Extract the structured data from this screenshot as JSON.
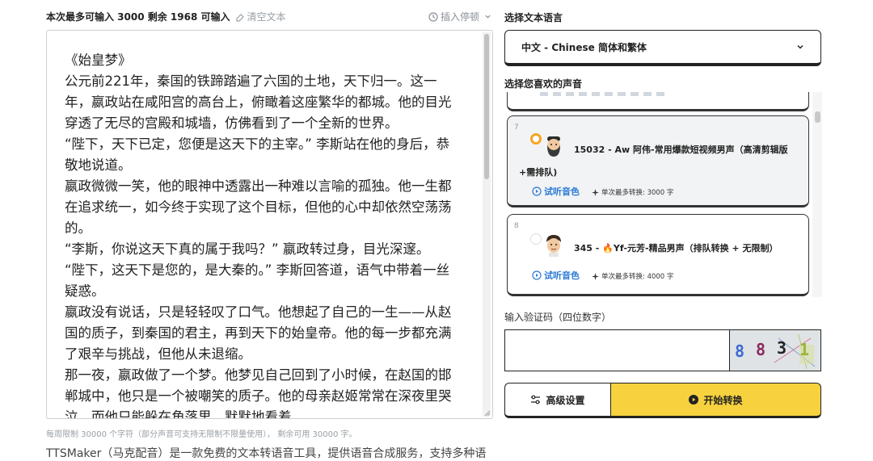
{
  "header": {
    "char_limit_text": "本次最多可输入 3000 剩余 1968 可输入",
    "clear_label": "清空文本",
    "insert_pause_label": "插入停顿"
  },
  "editor": {
    "paragraphs": [
      "《始皇梦》",
      "公元前221年，秦国的铁蹄踏遍了六国的土地，天下归一。这一年，嬴政站在咸阳宫的高台上，俯瞰着这座繁华的都城。他的目光穿透了无尽的宫殿和城墙，仿佛看到了一个全新的世界。",
      "“陛下，天下已定，您便是这天下的主宰。” 李斯站在他的身后，恭敬地说道。",
      "嬴政微微一笑，他的眼神中透露出一种难以言喻的孤独。他一生都在追求统一，如今终于实现了这个目标，但他的心中却依然空荡荡的。",
      "“李斯，你说这天下真的属于我吗？” 嬴政转过身，目光深邃。",
      "“陛下，这天下是您的，是大秦的。” 李斯回答道，语气中带着一丝疑惑。",
      "嬴政没有说话，只是轻轻叹了口气。他想起了自己的一生——从赵国的质子，到秦国的君主，再到天下的始皇帝。他的每一步都充满了艰辛与挑战，但他从未退缩。",
      "那一夜，嬴政做了一个梦。他梦见自己回到了小时候，在赵国的邯郸城中，他只是一个被嘲笑的质子。他的母亲赵姬常常在深夜里哭泣，而他只能躲在角落里，默默地看着。"
    ],
    "limit_note": "每周限制 30000 个字符（部分声音可支持无限制不限量使用）， 剩余可用 30000 字。",
    "about_text": "TTSMaker（马克配音）是一款免费的文本转语音工具，提供语音合成服务，支持多种语"
  },
  "language": {
    "label": "选择文本语言",
    "selected": "中文 - Chinese 简体和繁体"
  },
  "voices": {
    "label": "选择您喜欢的声音",
    "items": [
      {
        "index": "7",
        "name_line1": "15032 - Aw 阿伟-常用爆款短视频男声（高清剪辑版",
        "name_line2": "+需排队)",
        "listen_label": "试听音色",
        "max_label": "单次最多转换: 3000 字",
        "selected": true
      },
      {
        "index": "8",
        "name_line1": "345 - 🔥Yf-元芳-精品男声（排队转换 + 无限制）",
        "listen_label": "试听音色",
        "max_label": "单次最多转换: 4000 字",
        "selected": false
      }
    ]
  },
  "captcha": {
    "label": "输入验证码（四位数字）",
    "value": "",
    "image_digits": [
      "8",
      "8",
      "3",
      "1"
    ]
  },
  "actions": {
    "advanced_label": "高级设置",
    "start_label": "开始转换"
  },
  "colors": {
    "accent_yellow": "#f7d23e",
    "link_blue": "#2a7ad5",
    "radio_orange": "#f5a623",
    "border_dark": "#222222"
  }
}
